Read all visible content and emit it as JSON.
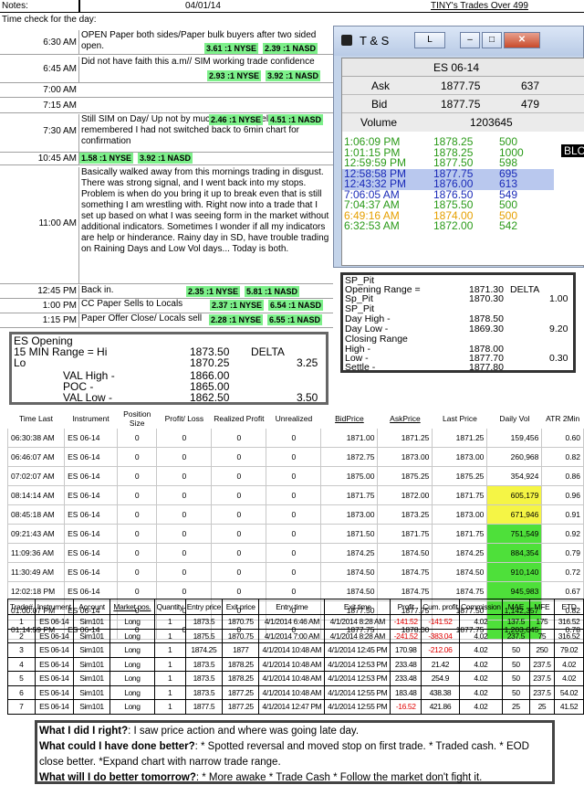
{
  "header": {
    "notes_label": "Notes:",
    "date": "04/01/14",
    "trades_title": "TINY's Trades Over 499"
  },
  "time_check_label": "Time check for the day:",
  "notes": [
    {
      "time": "6:30 AM",
      "text": "OPEN Paper both sides/Paper bulk buyers after two sided open.",
      "badge1": "3.61 :1 NYSE",
      "badge2": "2.39 :1 NASD"
    },
    {
      "time": "6:45 AM",
      "text": "Did not have faith this a.m// SIM working trade confidence",
      "badge1": "2.93 :1 NYSE",
      "badge2": "3.92 :1 NASD"
    },
    {
      "time": "7:00 AM",
      "text": ""
    },
    {
      "time": "7:15 AM",
      "text": ""
    },
    {
      "time": "7:30 AM",
      "text": "Still SIM on Day/ Up not by much though.  Feel better as just remembered I had not switched back to 6min chart for confirmation",
      "badge1": "2.46 :1 NYSE",
      "badge2": "4.51 :1 NASD"
    },
    {
      "time": "10:45 AM",
      "text": "",
      "badge1": "1.58 :1 NYSE",
      "badge2": "3.92 :1 NASD"
    },
    {
      "time": "11:00 AM",
      "text": "Basically walked away from this mornings trading in disgust.  There was strong signal, and I went back into my stops.  Problem is when do you bring it up to break even that is still something I am wrestling with.  Right now into a trade that I set up based on what I was seeing form in the market without additional indicators.  Sometimes I wonder if all my indicators are help or hinderance.  Rainy day in SD, have trouble trading on Raining Days and Low Vol days... Today is both."
    },
    {
      "time": "12:45 PM",
      "text": "Back in.",
      "badge1": "2.35 :1 NYSE",
      "badge2": "5.81 :1 NASD"
    },
    {
      "time": "1:00 PM",
      "text": "CC Paper Sells to Locals",
      "badge1": "2.37 :1 NYSE",
      "badge2": "6.54 :1 NASD"
    },
    {
      "time": "1:15 PM",
      "text": "Paper Offer Close/ Locals sell",
      "badge1": "2.28 :1 NYSE",
      "badge2": "6.55 :1 NASD"
    }
  ],
  "ts": {
    "title": "T & S",
    "btn_l": "L",
    "symbol": "ES 06-14",
    "ask_label": "Ask",
    "ask_price": "1877.75",
    "ask_size": "637",
    "bid_label": "Bid",
    "bid_price": "1877.75",
    "bid_size": "479",
    "volume_label": "Volume",
    "volume": "1203645",
    "blc": "BLC",
    "rows": [
      {
        "time": "1:06:09 PM",
        "price": "1878.25",
        "size": "500",
        "color": "#2a9a18"
      },
      {
        "time": "1:01:15 PM",
        "price": "1878.25",
        "size": "1000",
        "color": "#2a9a18"
      },
      {
        "time": "12:59:59 PM",
        "price": "1877.50",
        "size": "598",
        "color": "#2a9a18"
      },
      {
        "time": "12:58:58 PM",
        "price": "1877.75",
        "size": "695",
        "color": "#1a2ab8"
      },
      {
        "time": "12:43:32 PM",
        "price": "1876.00",
        "size": "613",
        "color": "#1a2ab8"
      },
      {
        "time": "7:06:05 AM",
        "price": "1876.50",
        "size": "549",
        "color": "#1a2ab8"
      },
      {
        "time": "7:04:37 AM",
        "price": "1875.50",
        "size": "500",
        "color": "#2a9a18"
      },
      {
        "time": "6:49:16 AM",
        "price": "1874.00",
        "size": "500",
        "color": "#e6a000"
      },
      {
        "time": "6:32:53 AM",
        "price": "1872.00",
        "size": "542",
        "color": "#2a9a18"
      }
    ]
  },
  "sp": {
    "l1": "SP_Pit",
    "l2": "Opening Range =",
    "v2": "1871.30",
    "delta": "DELTA",
    "l3": "Sp_Pit",
    "v3": "1870.30",
    "d3": "1.00",
    "l4": "SP_Pit",
    "l5": "Day High -",
    "v5": "1878.50",
    "l6": "Day Low -",
    "v6": "1869.30",
    "d6": "9.20",
    "l7": "Closing Range",
    "l8": "High -",
    "v8": "1878.00",
    "l9": "Low -",
    "v9": "1877.70",
    "d9": "0.30",
    "l10": "Settle -",
    "v10": "1877.80"
  },
  "es": {
    "title": "ES Opening",
    "range_label": "15 MIN Range = Hi",
    "hi": "1873.50",
    "delta": "DELTA",
    "lo_label": "Lo",
    "lo": "1870.25",
    "delta_val": "3.25",
    "val_high_label": "VAL High  -",
    "val_high": "1866.00",
    "poc_label": "POC  -",
    "poc": "1865.00",
    "val_low_label": "VAL Low  -",
    "val_low": "1862.50",
    "val_delta": "3.50"
  },
  "t1": {
    "headers": [
      "Time Last",
      "Instrument",
      "Position Size",
      "Profit/ Loss",
      "Realized Profit",
      "Unrealized",
      "BidPrice",
      "AskPrice",
      "Last Price",
      "Daily Vol",
      "ATR 2Min"
    ],
    "rows": [
      [
        "06:30:38 AM",
        "ES 06-14",
        "0",
        "0",
        "0",
        "0",
        "1871.00",
        "1871.25",
        "1871.25",
        "159,456",
        "0.60"
      ],
      [
        "06:46:07 AM",
        "ES 06-14",
        "0",
        "0",
        "0",
        "0",
        "1872.75",
        "1873.00",
        "1873.00",
        "260,968",
        "0.82"
      ],
      [
        "07:02:07 AM",
        "ES 06-14",
        "0",
        "0",
        "0",
        "0",
        "1875.00",
        "1875.25",
        "1875.25",
        "354,924",
        "0.86"
      ],
      [
        "08:14:14 AM",
        "ES 06-14",
        "0",
        "0",
        "0",
        "0",
        "1871.75",
        "1872.00",
        "1871.75",
        "605,179",
        "0.96"
      ],
      [
        "08:45:18 AM",
        "ES 06-14",
        "0",
        "0",
        "0",
        "0",
        "1873.00",
        "1873.25",
        "1873.00",
        "671,946",
        "0.91"
      ],
      [
        "09:21:43 AM",
        "ES 06-14",
        "0",
        "0",
        "0",
        "0",
        "1871.50",
        "1871.75",
        "1871.75",
        "751,549",
        "0.92"
      ],
      [
        "11:09:36 AM",
        "ES 06-14",
        "0",
        "0",
        "0",
        "0",
        "1874.25",
        "1874.50",
        "1874.25",
        "884,354",
        "0.79"
      ],
      [
        "11:30:49 AM",
        "ES 06-14",
        "0",
        "0",
        "0",
        "0",
        "1874.50",
        "1874.75",
        "1874.50",
        "910,140",
        "0.72"
      ],
      [
        "12:02:18 PM",
        "ES 06-14",
        "0",
        "0",
        "0",
        "0",
        "1874.50",
        "1874.75",
        "1874.75",
        "945,983",
        "0.67"
      ],
      [
        "01:00:07 PM",
        "ES 06-14",
        "0",
        "0",
        "0",
        "0",
        "1877.50",
        "1877.75",
        "1877.50",
        "1,142,357",
        "0.82"
      ],
      [
        "01:14:59 PM",
        "ES 06-14",
        "0",
        "0",
        "0",
        "0",
        "1877.75",
        "1878.00",
        "1877.75",
        "1,203,645",
        "0.78"
      ]
    ],
    "vol_colors": [
      "",
      "",
      "",
      "#f5f545",
      "#f5f545",
      "#4ee03a",
      "#4ee03a",
      "#4ee03a",
      "#4ee03a",
      "#4ee03a",
      "#4ee03a"
    ]
  },
  "t2": {
    "headers": [
      "Trade#",
      "Instrument",
      "Account",
      "Market pos.",
      "Quantity",
      "Entry price",
      "Exit price",
      "Entry time",
      "Exit time",
      "Profit",
      "Cum. profit",
      "Commission",
      "MAE",
      "MFE",
      "ETD"
    ],
    "rows": [
      [
        "1",
        "ES 06-14",
        "Sim101",
        "Long",
        "1",
        "1873.5",
        "1870.75",
        "4/1/2014 6:46 AM",
        "4/1/2014 8:28 AM",
        "-141.52",
        "-141.52",
        "4.02",
        "137.5",
        "175",
        "316.52"
      ],
      [
        "2",
        "ES 06-14",
        "Sim101",
        "Long",
        "1",
        "1875.5",
        "1870.75",
        "4/1/2014 7:00 AM",
        "4/1/2014 8:28 AM",
        "-241.52",
        "-383.04",
        "4.02",
        "237.5",
        "75",
        "316.52"
      ],
      [
        "3",
        "ES 06-14",
        "Sim101",
        "Long",
        "1",
        "1874.25",
        "1877",
        "4/1/2014 10:48 AM",
        "4/1/2014 12:45 PM",
        "170.98",
        "-212.06",
        "4.02",
        "50",
        "250",
        "79.02"
      ],
      [
        "4",
        "ES 06-14",
        "Sim101",
        "Long",
        "1",
        "1873.5",
        "1878.25",
        "4/1/2014 10:48 AM",
        "4/1/2014 12:53 PM",
        "233.48",
        "21.42",
        "4.02",
        "50",
        "237.5",
        "4.02"
      ],
      [
        "5",
        "ES 06-14",
        "Sim101",
        "Long",
        "1",
        "1873.5",
        "1878.25",
        "4/1/2014 10:48 AM",
        "4/1/2014 12:53 PM",
        "233.48",
        "254.9",
        "4.02",
        "50",
        "237.5",
        "4.02"
      ],
      [
        "6",
        "ES 06-14",
        "Sim101",
        "Long",
        "1",
        "1873.5",
        "1877.25",
        "4/1/2014 10:48 AM",
        "4/1/2014 12:55 PM",
        "183.48",
        "438.38",
        "4.02",
        "50",
        "237.5",
        "54.02"
      ],
      [
        "7",
        "ES 06-14",
        "Sim101",
        "Long",
        "1",
        "1877.5",
        "1877.25",
        "4/1/2014 12:47 PM",
        "4/1/2014 12:55 PM",
        "-16.52",
        "421.86",
        "4.02",
        "25",
        "25",
        "41.52"
      ]
    ]
  },
  "review": {
    "q1": "What I did I right?",
    "a1": ": I saw price action and where was going late day.",
    "q2": "What could I have done better?",
    "a2": ": * Spotted reversal and moved stop on first trade. * Traded cash. * EOD close better. *Expand chart with narrow trade range.",
    "q3": "What will I do better tomorrow?",
    "a3": ": * More awake * Trade Cash * Follow the market don't fight it."
  }
}
